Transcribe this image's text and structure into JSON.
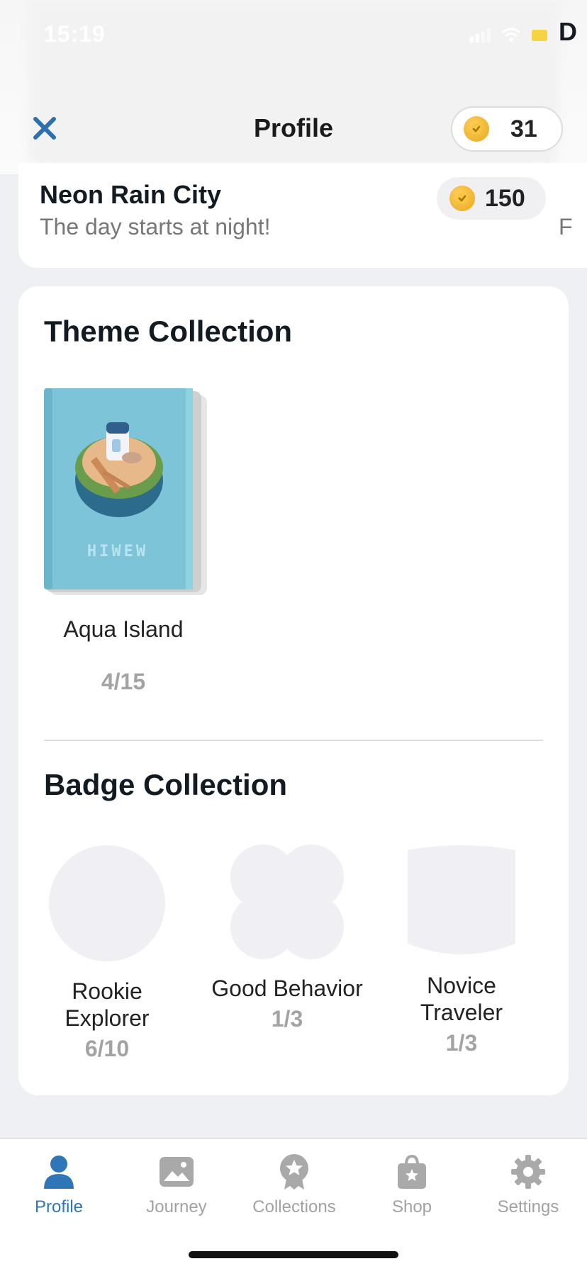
{
  "status_bar": {
    "time": "15:19"
  },
  "header": {
    "title": "Profile",
    "coin_balance": "31"
  },
  "current_theme_item": {
    "name": "Neon Rain City",
    "description": "The day starts at night!",
    "price": "150",
    "next_item_name_peek": "D",
    "next_item_desc_peek": "F"
  },
  "theme_collection": {
    "title": "Theme Collection",
    "items": [
      {
        "name": "Aqua Island",
        "progress": "4/15",
        "cover_text": "HIWEW"
      }
    ]
  },
  "badge_collection": {
    "title": "Badge Collection",
    "badges": [
      {
        "name": "Rookie Explorer",
        "progress": "6/10",
        "shape": "circle-icon"
      },
      {
        "name": "Good Behavior",
        "progress": "1/3",
        "shape": "flower-icon"
      },
      {
        "name": "Novice Traveler",
        "progress": "1/3",
        "shape": "shield-icon"
      }
    ]
  },
  "tab_bar": {
    "tabs": [
      {
        "label": "Profile",
        "icon": "person-icon",
        "active": true
      },
      {
        "label": "Journey",
        "icon": "image-icon",
        "active": false
      },
      {
        "label": "Collections",
        "icon": "award-icon",
        "active": false
      },
      {
        "label": "Shop",
        "icon": "shopping-bag-icon",
        "active": false
      },
      {
        "label": "Settings",
        "icon": "gear-icon",
        "active": false
      }
    ]
  },
  "colors": {
    "accent": "#2f76b8",
    "background": "#eff0f4",
    "coin": "#f0b52e",
    "badge_placeholder": "#f0f0f4"
  }
}
